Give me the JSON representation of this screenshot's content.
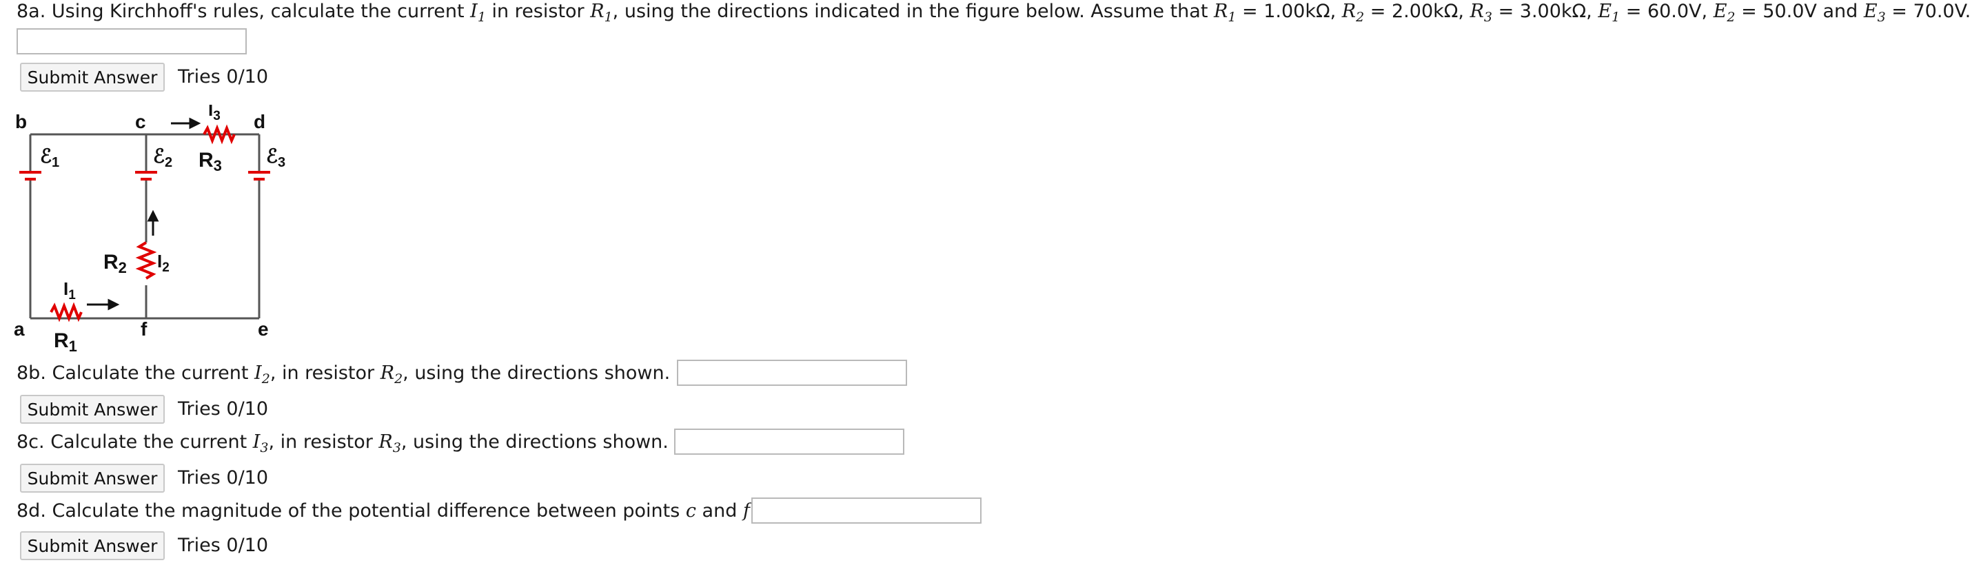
{
  "q8a": {
    "intro": "8a. Using Kirchhoff's rules, calculate the current ",
    "i1": "I",
    "i1_sub": "1",
    "mid": " in resistor ",
    "r1": "R",
    "r1_sub": "1",
    "directions": ", using the directions indicated in the figure below. Assume that ",
    "r1b": "R",
    "r1b_sub": "1",
    "r1_val": " = 1.00kΩ, ",
    "r2": "R",
    "r2_sub": "2",
    "r2_val": " = 2.00kΩ, ",
    "r3": "R",
    "r3_sub": "3",
    "r3_val": " = 3.00kΩ, ",
    "e1": "E",
    "e1_sub": "1",
    "e1_val": " = 60.0V, ",
    "e2": "E",
    "e2_sub": "2",
    "e2_val": " = 50.0V and ",
    "e3": "E",
    "e3_sub": "3",
    "e3_val": " = 70.0V.",
    "answer_value": "",
    "submit_label": "Submit Answer",
    "tries": "Tries 0/10"
  },
  "q8b": {
    "intro": "8b. Calculate the current ",
    "i": "I",
    "i_sub": "2",
    "mid": ", in resistor ",
    "r": "R",
    "r_sub": "2",
    "end": ", using the directions shown.",
    "answer_value": "",
    "submit_label": "Submit Answer",
    "tries": "Tries 0/10"
  },
  "q8c": {
    "intro": "8c. Calculate the current ",
    "i": "I",
    "i_sub": "3",
    "mid": ", in resistor ",
    "r": "R",
    "r_sub": "3",
    "end": ", using the directions shown.",
    "answer_value": "",
    "submit_label": "Submit Answer",
    "tries": "Tries 0/10"
  },
  "q8d": {
    "intro": "8d. Calculate the magnitude of the potential difference between points ",
    "c": "c",
    "and": " and ",
    "f": "f",
    "end": ".",
    "answer_value": "",
    "submit_label": "Submit Answer",
    "tries": "Tries 0/10"
  },
  "circuit": {
    "node_a": "a",
    "node_b": "b",
    "node_c": "c",
    "node_d": "d",
    "node_e": "e",
    "node_f": "f",
    "emf1": "ℰ",
    "emf1_sub": "1",
    "emf2": "ℰ",
    "emf2_sub": "2",
    "emf3": "ℰ",
    "emf3_sub": "3",
    "res1": "R",
    "res1_sub": "1",
    "res2": "R",
    "res2_sub": "2",
    "res3": "R",
    "res3_sub": "3",
    "cur1": "I",
    "cur1_sub": "1",
    "cur2": "I",
    "cur2_sub": "2",
    "cur3": "I",
    "cur3_sub": "3",
    "wire_color": "#555555",
    "element_color": "#e00000"
  }
}
